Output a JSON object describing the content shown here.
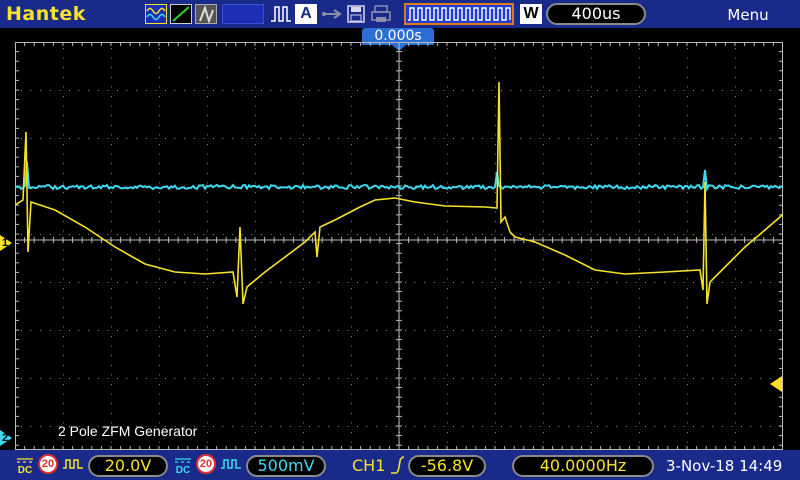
{
  "header": {
    "brand": "Hantek",
    "timebase": "400us",
    "waveform_mode": "W",
    "menu_label": "Menu",
    "toolbar_icons": [
      "ac-coupling-wave-icon",
      "ramp-icon",
      "persistence-icon",
      "pulse-icon",
      "auto-icon",
      "usb-icon",
      "save-icon",
      "print-icon",
      "waveform-memory-icon"
    ],
    "auto_label": "A"
  },
  "display": {
    "trigger_time": "0.000s",
    "ch1_marker": "1",
    "ch2_marker": "2",
    "caption": "2 Pole ZFM Generator",
    "ch1_color": "#f7e12a",
    "ch2_color": "#3ed9ee"
  },
  "footer": {
    "ch1": {
      "coupling": "DC",
      "bw_limit": "20",
      "volts_per_div": "20.0V"
    },
    "ch2": {
      "coupling": "DC",
      "bw_limit": "20",
      "volts_per_div": "500mV"
    },
    "trigger": {
      "source": "CH1",
      "edge": "rising",
      "level": "-56.8V"
    },
    "frequency": "40.0000Hz",
    "datetime": "3-Nov-18 14:49"
  }
}
